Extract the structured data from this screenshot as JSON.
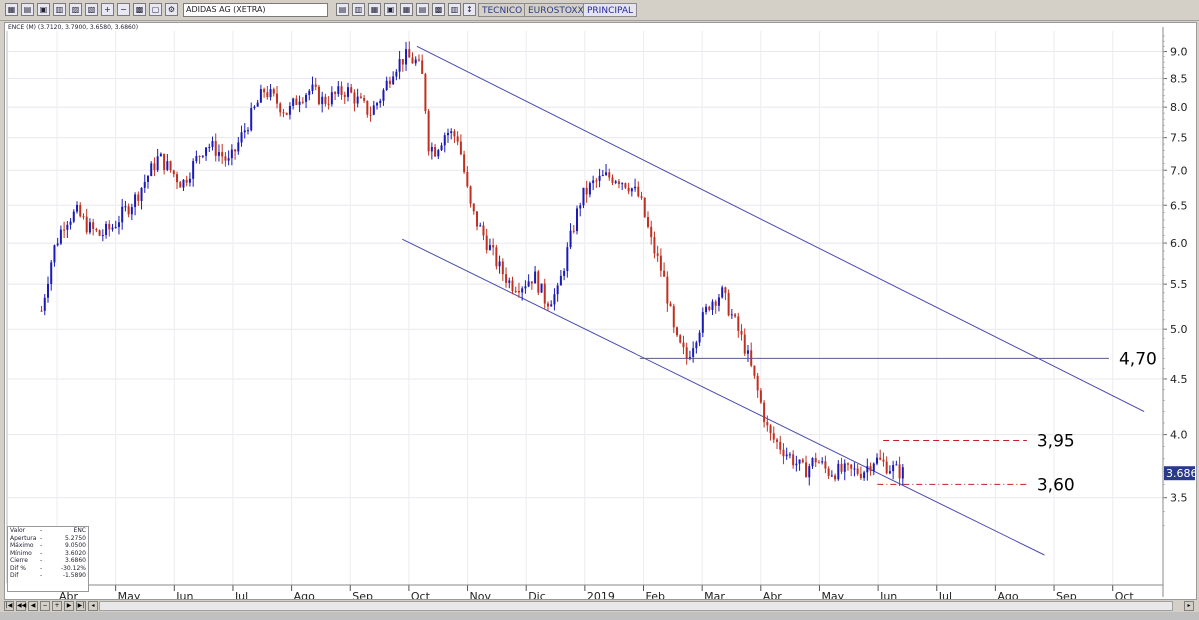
{
  "toolbar": {
    "symbol": "ADIDAS AG (XETRA)",
    "tabs": [
      "TECNICO",
      "EUROSTOXX",
      "PRINCIPAL"
    ],
    "active_tab": "PRINCIPAL"
  },
  "info_panel": {
    "rows": [
      {
        "key": "Valor",
        "dash": "-",
        "value": "ENC"
      },
      {
        "key": "Apertura",
        "dash": "-",
        "value": "5.2750"
      },
      {
        "key": "Máximo",
        "dash": "-",
        "value": "9.0500"
      },
      {
        "key": "Mínimo",
        "dash": "-",
        "value": "3.6020"
      },
      {
        "key": "Cierre",
        "dash": "-",
        "value": "3.6860"
      },
      {
        "key": "Dif %",
        "dash": "-",
        "value": "-30.12%"
      },
      {
        "key": "Dif",
        "dash": "-",
        "value": "-1.5890"
      }
    ]
  },
  "chart_data": {
    "type": "candlestick",
    "title": "ENCE (M) (3.7120, 3.7900, 3.6580, 3.6860)",
    "months": [
      "Abr",
      "May",
      "Jun",
      "Jul",
      "Ago",
      "Sep",
      "Oct",
      "Nov",
      "Dic",
      "2019",
      "Feb",
      "Mar",
      "Abr",
      "May",
      "Jun",
      "Jul",
      "Ago",
      "Sep",
      "Oct"
    ],
    "y_ticks": [
      "9.0",
      "8.5",
      "8.0",
      "7.5",
      "7.0",
      "6.5",
      "6.0",
      "5.5",
      "5.0",
      "4.5",
      "4.0",
      "3.5"
    ],
    "y_tick_values": [
      9.0,
      8.5,
      8.0,
      7.5,
      7.0,
      6.5,
      6.0,
      5.5,
      5.0,
      4.5,
      4.0,
      3.5
    ],
    "ylim": [
      3.1,
      9.4
    ],
    "y_scale": "log",
    "last_price_label": "3.686",
    "last_price": 3.686,
    "price_path_months": [
      -0.4,
      -0.2,
      0.0,
      0.2,
      0.4,
      0.6,
      0.8,
      1.0,
      1.2,
      1.4,
      1.6,
      1.8,
      2.0,
      2.2,
      2.4,
      2.6,
      2.8,
      3.0,
      3.2,
      3.4,
      3.6,
      3.8,
      4.0,
      4.2,
      4.4,
      4.6,
      4.8,
      5.0,
      5.2,
      5.4,
      5.6,
      5.8,
      6.0,
      6.1,
      6.2,
      6.3,
      6.5,
      6.7,
      6.9,
      7.0,
      7.2,
      7.4,
      7.6,
      7.8,
      8.0,
      8.2,
      8.4,
      8.6,
      8.8,
      9.0,
      9.2,
      9.4,
      9.6,
      9.8,
      10.0,
      10.2,
      10.4,
      10.6,
      10.8,
      11.0,
      11.2,
      11.4,
      11.6,
      11.8,
      12.0,
      12.2,
      12.4,
      12.6,
      12.8,
      13.0,
      13.2,
      13.4,
      13.6,
      13.8,
      14.0,
      14.2,
      14.3
    ],
    "price_path_values": [
      5.2,
      5.9,
      6.3,
      6.4,
      6.2,
      6.1,
      6.2,
      6.4,
      6.6,
      6.9,
      7.2,
      7.0,
      6.8,
      7.1,
      7.4,
      7.3,
      7.1,
      7.5,
      7.9,
      8.3,
      8.1,
      7.9,
      8.2,
      8.3,
      8.1,
      8.2,
      8.3,
      8.1,
      7.9,
      8.2,
      8.7,
      8.9,
      8.8,
      8.5,
      7.4,
      7.3,
      7.6,
      7.5,
      6.5,
      6.3,
      6.0,
      5.7,
      5.5,
      5.5,
      5.6,
      5.3,
      5.4,
      6.0,
      6.6,
      6.8,
      6.9,
      6.9,
      6.8,
      6.6,
      6.0,
      5.6,
      4.9,
      4.7,
      5.0,
      5.3,
      5.4,
      5.1,
      4.8,
      4.4,
      4.0,
      3.9,
      3.8,
      3.7,
      3.8,
      3.7,
      3.7,
      3.7,
      3.7,
      3.8,
      3.75,
      3.7,
      3.69
    ],
    "trendlines": [
      {
        "name": "upper-channel",
        "m1": 6.0,
        "v1": 9.1,
        "m2": 18.4,
        "v2": 4.2
      },
      {
        "name": "lower-channel",
        "m1": 5.75,
        "v1": 6.05,
        "m2": 16.7,
        "v2": 3.1
      }
    ],
    "horizontal_levels": [
      {
        "label": "4,70",
        "value": 4.7,
        "m_start": 9.8,
        "m_end": 17.8,
        "style": "solid"
      },
      {
        "label": "3,95",
        "value": 3.95,
        "m_start": 13.95,
        "m_end": 16.4,
        "style": "dashed"
      },
      {
        "label": "3,60",
        "value": 3.6,
        "m_start": 13.85,
        "m_end": 16.4,
        "style": "dashdot"
      }
    ],
    "colors": {
      "up": "#1a1ab4",
      "down": "#c03020",
      "channel": "#4a4ab0",
      "level_4_70": "#5a5a8a",
      "level_red": "#c02020",
      "last_price_bg": "#2a3a8a"
    }
  }
}
